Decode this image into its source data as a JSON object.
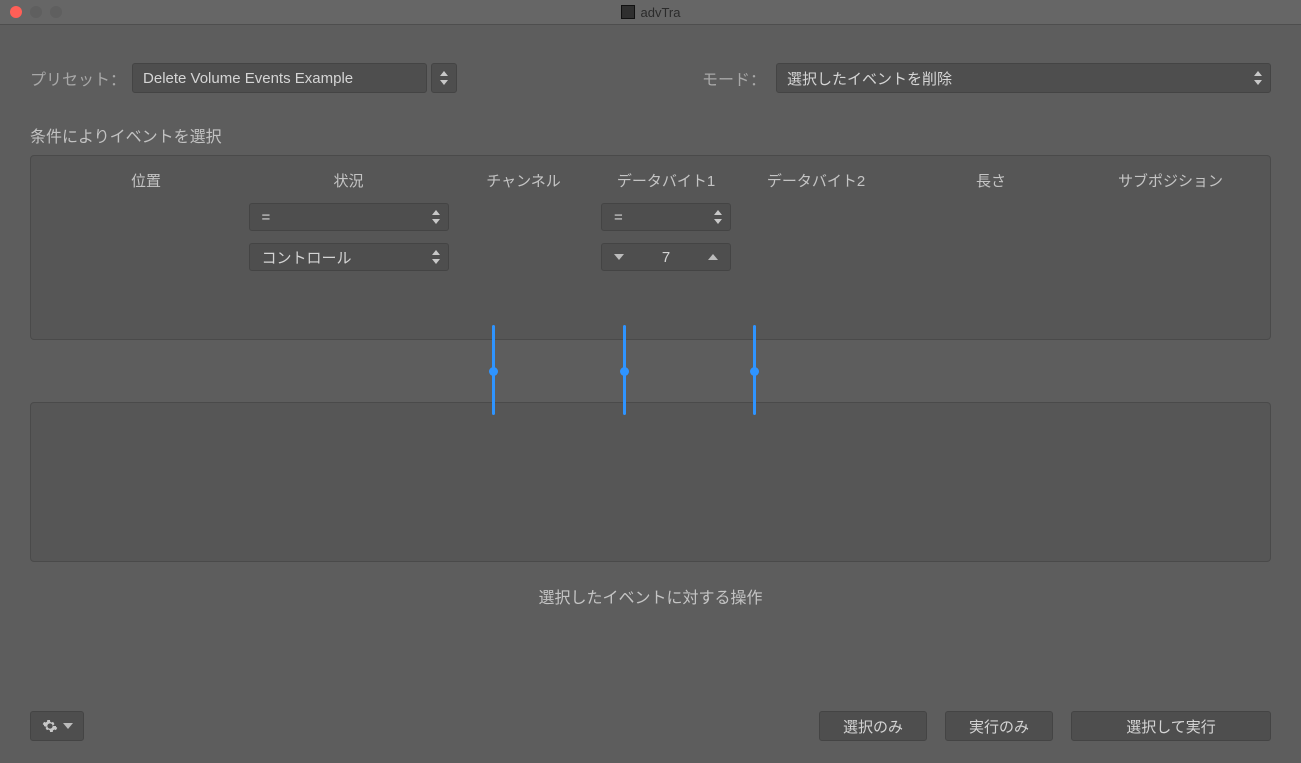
{
  "window": {
    "title": "advTra"
  },
  "top": {
    "preset_label": "プリセット：",
    "preset_value": "Delete Volume Events Example",
    "mode_label": "モード：",
    "mode_value": "選択したイベントを削除"
  },
  "section": {
    "conditions_label": "条件によりイベントを選択",
    "operations_label": "選択したイベントに対する操作"
  },
  "columns": {
    "position": "位置",
    "status": "状況",
    "channel": "チャンネル",
    "data1": "データバイト1",
    "data2": "データバイト2",
    "length": "長さ",
    "subposition": "サブポジション"
  },
  "conditions": {
    "status_op": "=",
    "status_type": "コントロール",
    "data1_op": "=",
    "data1_value": "7"
  },
  "footer": {
    "select_only": "選択のみ",
    "execute_only": "実行のみ",
    "select_execute": "選択して実行"
  }
}
